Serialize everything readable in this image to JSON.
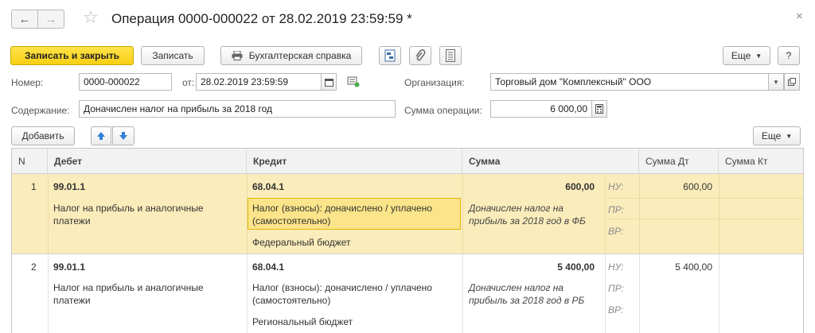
{
  "window": {
    "title": "Операция 0000-000022 от 28.02.2019 23:59:59 *",
    "back_glyph": "←",
    "forward_glyph": "→",
    "star_glyph": "☆",
    "close_glyph": "×"
  },
  "toolbar": {
    "save_close_label": "Записать и закрыть",
    "save_label": "Записать",
    "report_label": "Бухгалтерская справка",
    "more_label": "Еще",
    "help_label": "?"
  },
  "form": {
    "number_label": "Номер:",
    "number_value": "0000-000022",
    "date_label": "от:",
    "date_value": "28.02.2019 23:59:59",
    "org_label": "Организация:",
    "org_value": "Торговый дом \"Комплексный\" ООО",
    "content_label": "Содержание:",
    "content_value": "Доначислен налог на прибыль за 2018 год",
    "sum_label": "Сумма операции:",
    "sum_value": "6 000,00"
  },
  "table_toolbar": {
    "add_label": "Добавить",
    "more_label": "Еще"
  },
  "table": {
    "columns": [
      "N",
      "Дебет",
      "Кредит",
      "Сумма",
      "Сумма Дт",
      "Сумма Кт"
    ],
    "rows": [
      {
        "n": "1",
        "debit_account": "99.01.1",
        "debit_sub": "Налог на прибыль и аналогичные платежи",
        "credit_account": "68.04.1",
        "credit_sub1": "Налог (взносы): доначислено / уплачено (самостоятельно)",
        "credit_sub2": "Федеральный бюджет",
        "amount": "600,00",
        "description": "Доначислен налог на прибыль за 2018 год в ФБ",
        "nu_label": "НУ:",
        "pr_label": "ПР:",
        "vr_label": "ВР:",
        "sum_dt": "600,00",
        "sum_kt": ""
      },
      {
        "n": "2",
        "debit_account": "99.01.1",
        "debit_sub": "Налог на прибыль и аналогичные платежи",
        "credit_account": "68.04.1",
        "credit_sub1": "Налог (взносы): доначислено / уплачено (самостоятельно)",
        "credit_sub2": "Региональный бюджет",
        "amount": "5 400,00",
        "description": "Доначислен налог на прибыль за 2018 год в РБ",
        "nu_label": "НУ:",
        "pr_label": "ПР:",
        "vr_label": "ВР:",
        "sum_dt": "5 400,00",
        "sum_kt": ""
      }
    ]
  }
}
